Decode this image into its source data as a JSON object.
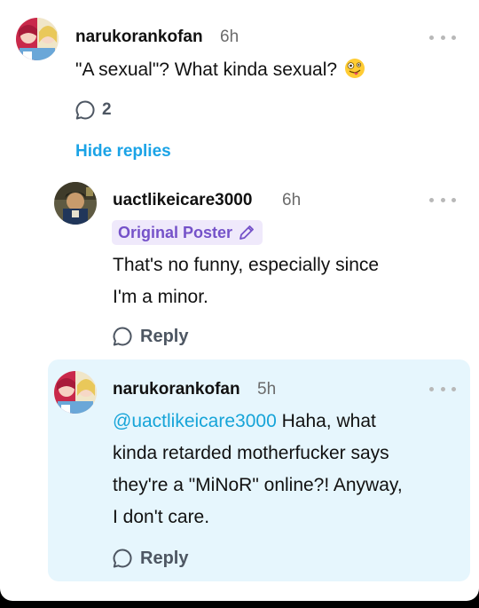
{
  "thread": {
    "parent": {
      "username": "narukorankofan",
      "time": "6h",
      "text": "\"A sexual\"? What kinda sexual?",
      "emoji_icon": "zany-face-emoji",
      "reply_count": "2",
      "hide_replies_label": "Hide replies"
    },
    "replies": [
      {
        "username": "uactlikeicare3000",
        "time": "6h",
        "badge": "Original Poster",
        "text_line1": "That's no funny, especially since",
        "text_line2": "I'm a minor.",
        "reply_label": "Reply"
      },
      {
        "username": "narukorankofan",
        "time": "5h",
        "mention": "@uactlikeicare3000",
        "text_line1_rest": " Haha, what",
        "text_line2": "kinda retarded motherfucker says",
        "text_line3": "they're a \"MiNoR\" online?! Anyway,",
        "text_line4": "I don't care.",
        "reply_label": "Reply",
        "highlighted": true
      }
    ]
  },
  "colors": {
    "accent_link": "#1aa3e6",
    "mention": "#16a4d8",
    "op_badge_bg": "#efe9fb",
    "op_badge_text": "#7552c9",
    "highlight_bg": "#e6f6fd"
  }
}
